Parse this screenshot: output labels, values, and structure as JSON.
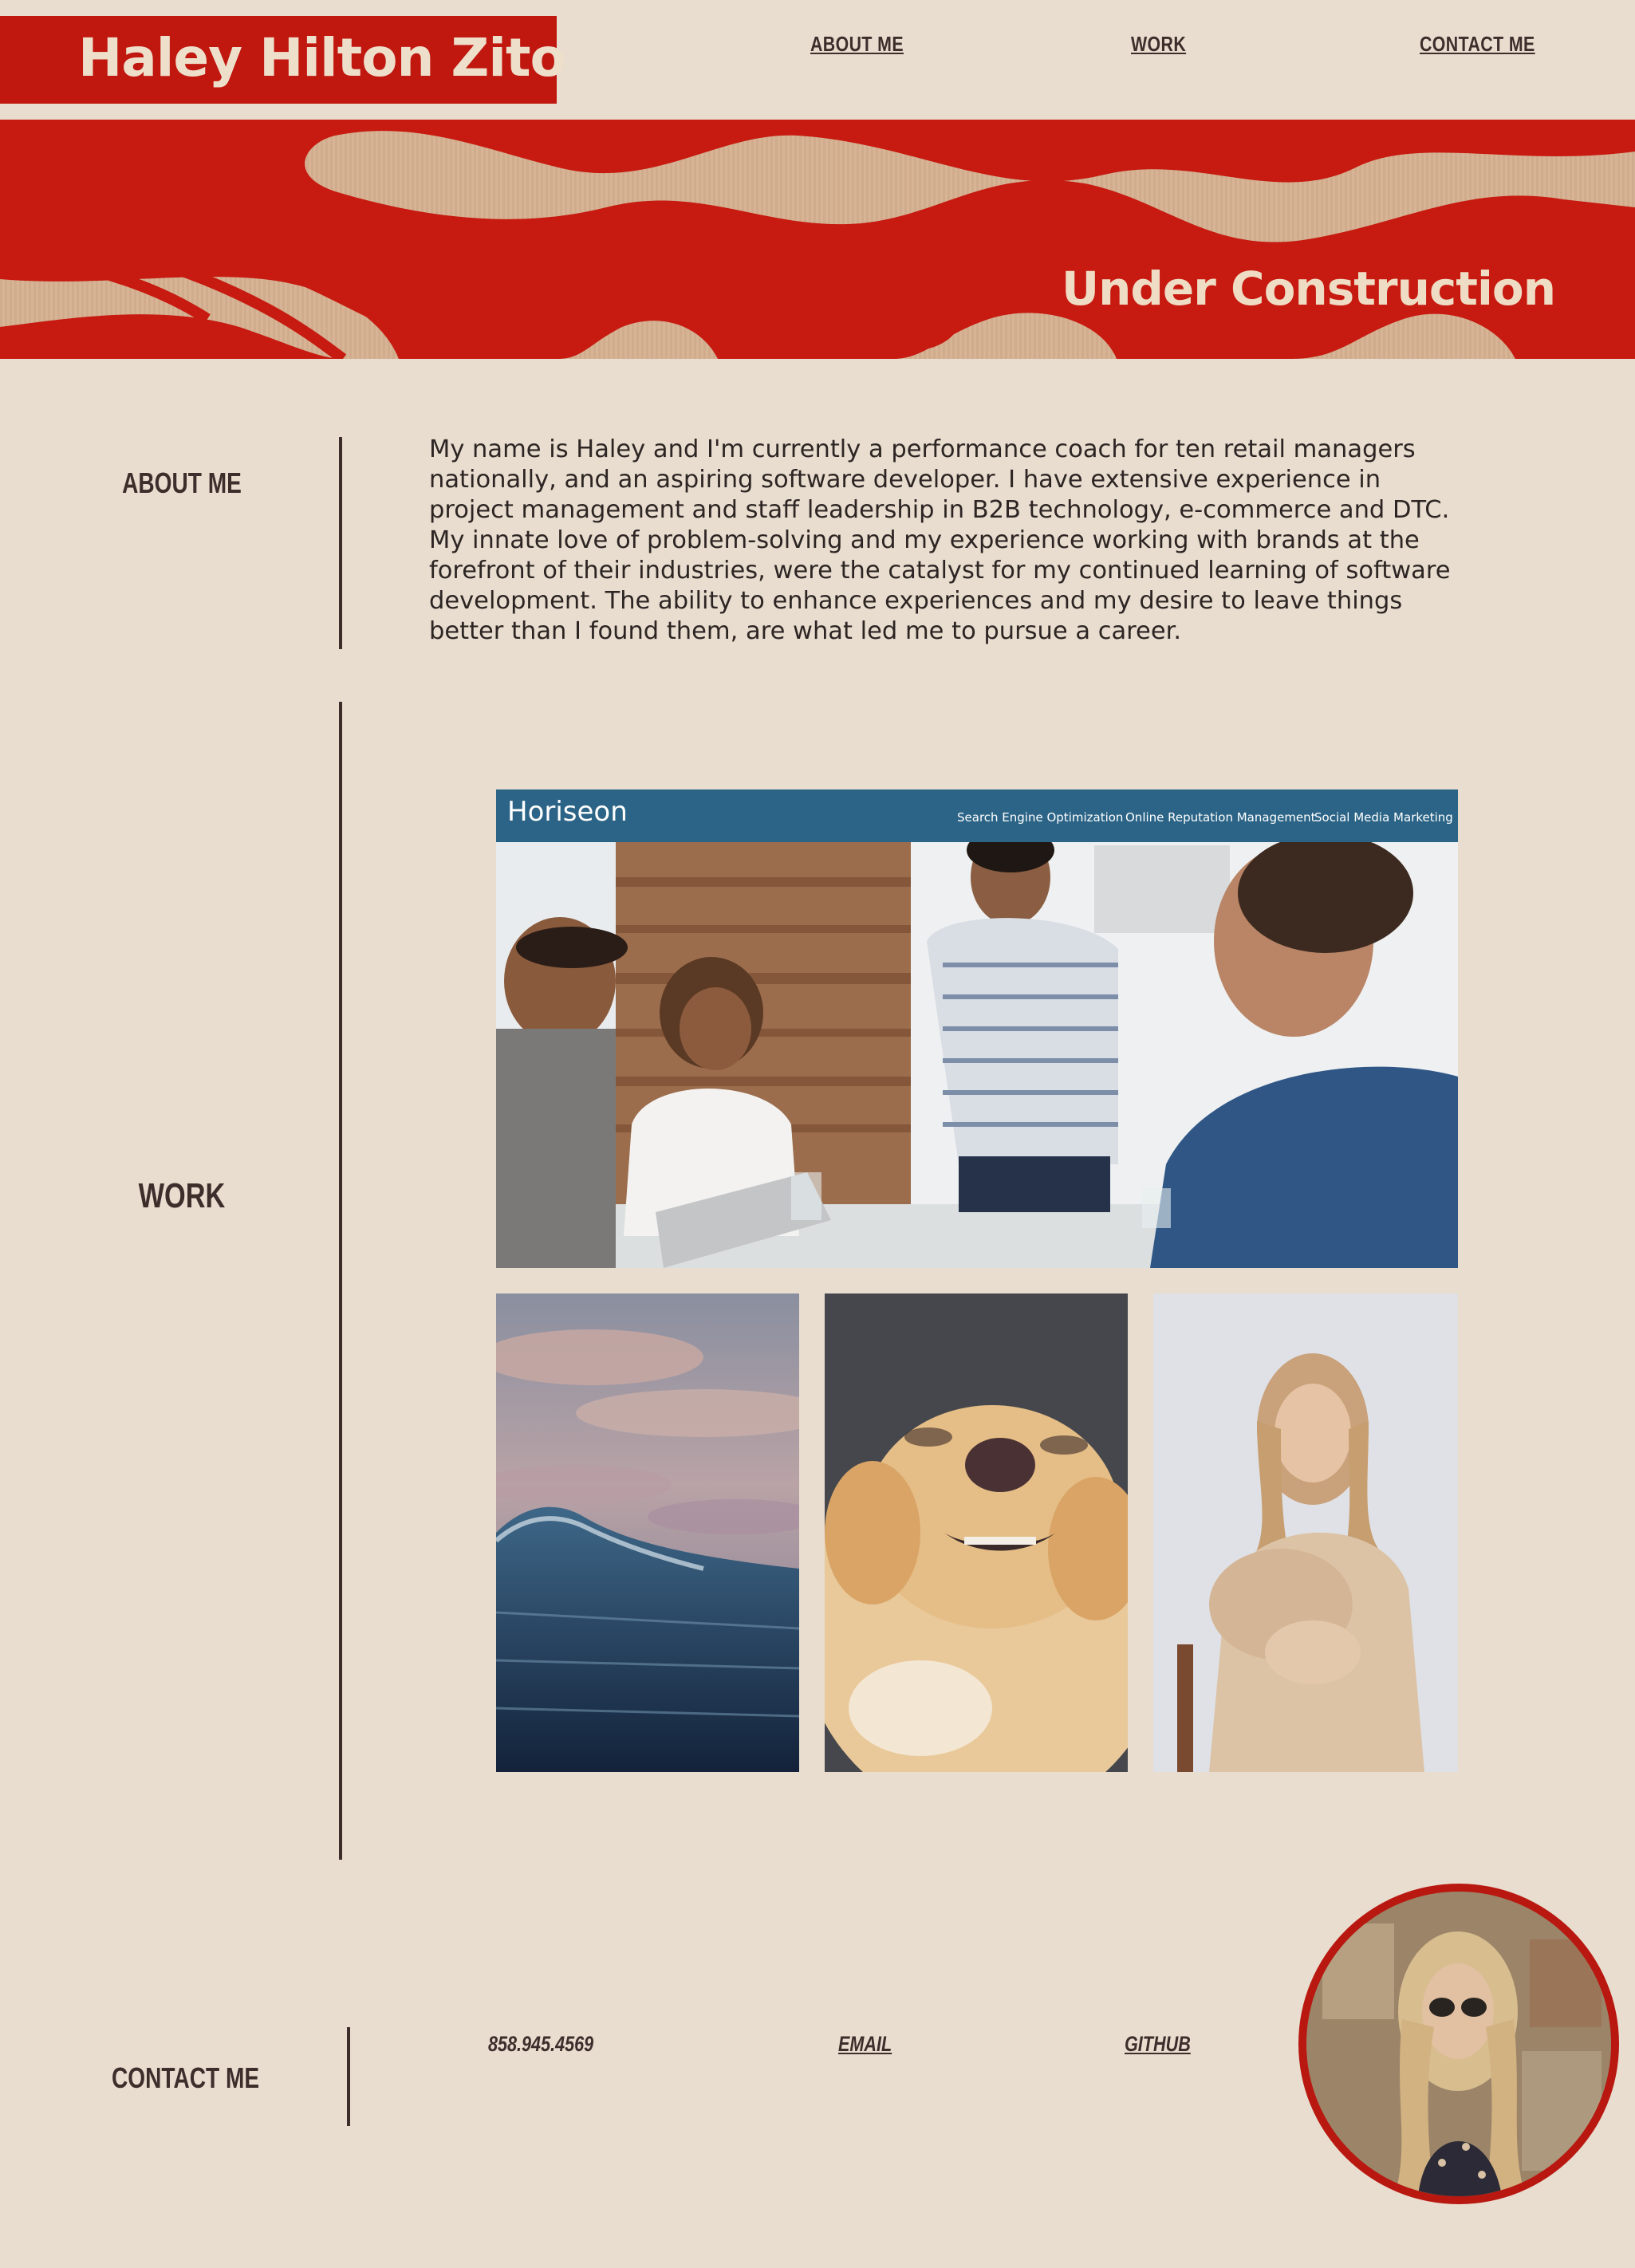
{
  "header": {
    "site_title": "Haley Hilton Zito",
    "nav": [
      {
        "label": "ABOUT ME"
      },
      {
        "label": "WORK"
      },
      {
        "label": "CONTACT ME"
      }
    ]
  },
  "banner": {
    "text": "Under Construction"
  },
  "about": {
    "label": "ABOUT ME",
    "text": "My name is Haley and I'm currently a performance coach for ten retail managers nationally, and an aspiring software developer. I have extensive experience in project management and staff leadership in B2B technology, e-commerce and DTC. My innate love of problem-solving and my experience working with brands at the forefront of their industries, were the catalyst for my continued learning of software development. The ability to enhance experiences and my desire to leave things better than I found them, are what led me to pursue a career."
  },
  "work": {
    "label": "WORK",
    "featured": {
      "logo": "Horiseon",
      "nav": [
        "Search Engine Optimization",
        "Online Reputation Management",
        "Social Media Marketing"
      ]
    }
  },
  "contact": {
    "label": "CONTACT ME",
    "phone": "858.945.4569",
    "email_label": "EMAIL",
    "github_label": "GITHUB"
  },
  "colors": {
    "background": "#e8ddcf",
    "accent_red": "#c0170f",
    "text_dark": "#3d2e2c",
    "horiseon_blue": "#2b6486"
  }
}
